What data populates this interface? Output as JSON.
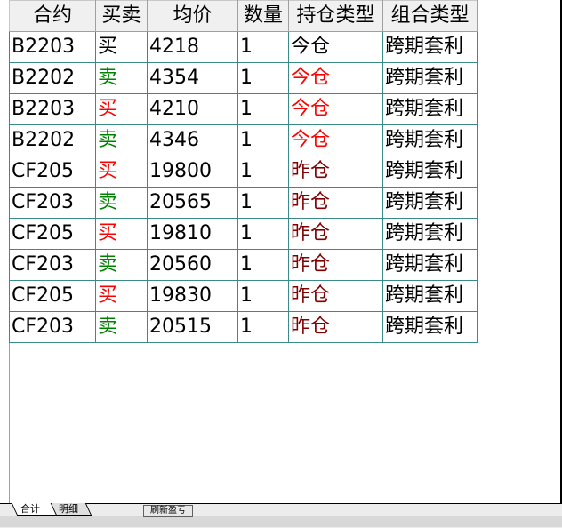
{
  "columns": [
    "合约",
    "买卖",
    "均价",
    "数量",
    "持仓类型",
    "组合类型"
  ],
  "rows": [
    {
      "contract": "B2203",
      "side": "买",
      "side_type": "buy",
      "side_color": "#000000",
      "price": "4218",
      "qty": "1",
      "pos_type": "今仓",
      "pos_color": "#000000",
      "combo": "跨期套利"
    },
    {
      "contract": "B2202",
      "side": "卖",
      "side_type": "sell",
      "side_color": "#008000",
      "price": "4354",
      "qty": "1",
      "pos_type": "今仓",
      "pos_color": "#ff0000",
      "combo": "跨期套利"
    },
    {
      "contract": "B2203",
      "side": "买",
      "side_type": "buy",
      "side_color": "#ff0000",
      "price": "4210",
      "qty": "1",
      "pos_type": "今仓",
      "pos_color": "#ff0000",
      "combo": "跨期套利"
    },
    {
      "contract": "B2202",
      "side": "卖",
      "side_type": "sell",
      "side_color": "#008000",
      "price": "4346",
      "qty": "1",
      "pos_type": "今仓",
      "pos_color": "#ff0000",
      "combo": "跨期套利"
    },
    {
      "contract": "CF205",
      "side": "买",
      "side_type": "buy",
      "side_color": "#ff0000",
      "price": "19800",
      "qty": "1",
      "pos_type": "昨仓",
      "pos_color": "#800000",
      "combo": "跨期套利"
    },
    {
      "contract": "CF203",
      "side": "卖",
      "side_type": "sell",
      "side_color": "#008000",
      "price": "20565",
      "qty": "1",
      "pos_type": "昨仓",
      "pos_color": "#800000",
      "combo": "跨期套利"
    },
    {
      "contract": "CF205",
      "side": "买",
      "side_type": "buy",
      "side_color": "#ff0000",
      "price": "19810",
      "qty": "1",
      "pos_type": "昨仓",
      "pos_color": "#800000",
      "combo": "跨期套利"
    },
    {
      "contract": "CF203",
      "side": "卖",
      "side_type": "sell",
      "side_color": "#008000",
      "price": "20560",
      "qty": "1",
      "pos_type": "昨仓",
      "pos_color": "#800000",
      "combo": "跨期套利"
    },
    {
      "contract": "CF205",
      "side": "买",
      "side_type": "buy",
      "side_color": "#ff0000",
      "price": "19830",
      "qty": "1",
      "pos_type": "昨仓",
      "pos_color": "#800000",
      "combo": "跨期套利"
    },
    {
      "contract": "CF203",
      "side": "卖",
      "side_type": "sell",
      "side_color": "#008000",
      "price": "20515",
      "qty": "1",
      "pos_type": "昨仓",
      "pos_color": "#800000",
      "combo": "跨期套利"
    }
  ],
  "tabs": [
    {
      "label": "合计",
      "active": true
    },
    {
      "label": "明细",
      "active": false
    }
  ],
  "refresh_label": "刷新盈亏",
  "colors": {
    "grid_line": "#3a8a8a",
    "buy": "#ff0000",
    "sell": "#008000",
    "pos_today": "#ff0000",
    "pos_yesterday": "#800000"
  }
}
